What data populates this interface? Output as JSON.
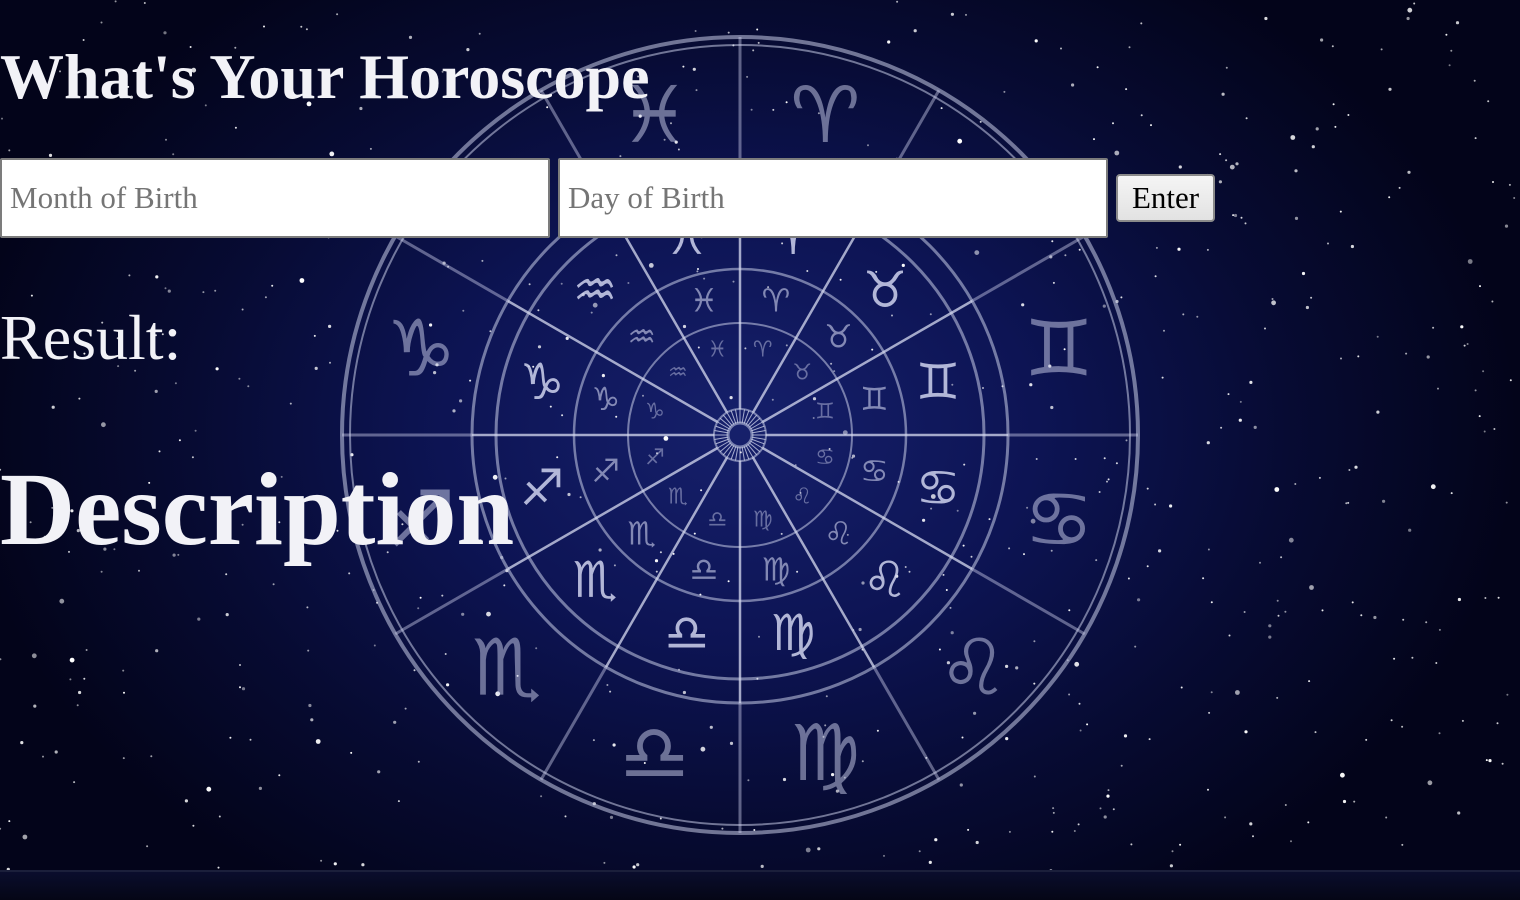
{
  "header": {
    "title": "What's Your Horoscope"
  },
  "form": {
    "month_placeholder": "Month of Birth",
    "day_placeholder": "Day of Birth",
    "month_value": "",
    "day_value": "",
    "enter_label": "Enter"
  },
  "result": {
    "label": "Result:",
    "description": "Description"
  },
  "background": {
    "image": "zodiac-wheel-starry-sky",
    "colors": {
      "sky_center": "#16206b",
      "sky_edge": "#03041a",
      "wheel_lines": "#c9cde8",
      "text": "#f2f2f7"
    }
  }
}
